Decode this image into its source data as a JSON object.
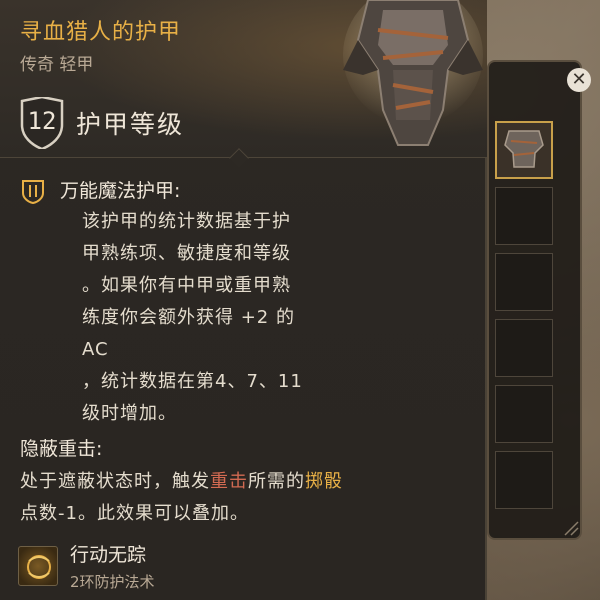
{
  "item": {
    "name": "寻血猎人的护甲",
    "rarity_type": "传奇 轻甲",
    "armor_class_value": "12",
    "armor_class_label": "护甲等级"
  },
  "feature": {
    "title": "万能魔法护甲:",
    "lines": [
      "该护甲的统计数据基于护",
      "甲熟练项、敏捷度和等级",
      "。如果你有中甲或重甲熟",
      "练度你会额外获得 +2 的",
      "AC",
      "，统计数据在第4、7、11",
      "级时增加。"
    ]
  },
  "hidden_strike": {
    "title": "隐蔽重击:",
    "line1_prefix": "处于遮蔽状态时，触发",
    "line1_highlight": "重击",
    "line1_suffix": "所需的",
    "line1_highlight2": "掷骰",
    "line2": "点数-1。此效果可以叠加。"
  },
  "spell": {
    "name": "行动无踪",
    "level": "2环防护法术"
  },
  "side_panel": {
    "close_symbol": "✕",
    "slots": [
      "armor-slot-1",
      "empty-slot-2",
      "empty-slot-3",
      "empty-slot-4",
      "empty-slot-5",
      "empty-slot-6"
    ]
  },
  "colors": {
    "title_gold": "#e8b046",
    "text": "#e4dccd",
    "subtext": "#b9a995"
  }
}
